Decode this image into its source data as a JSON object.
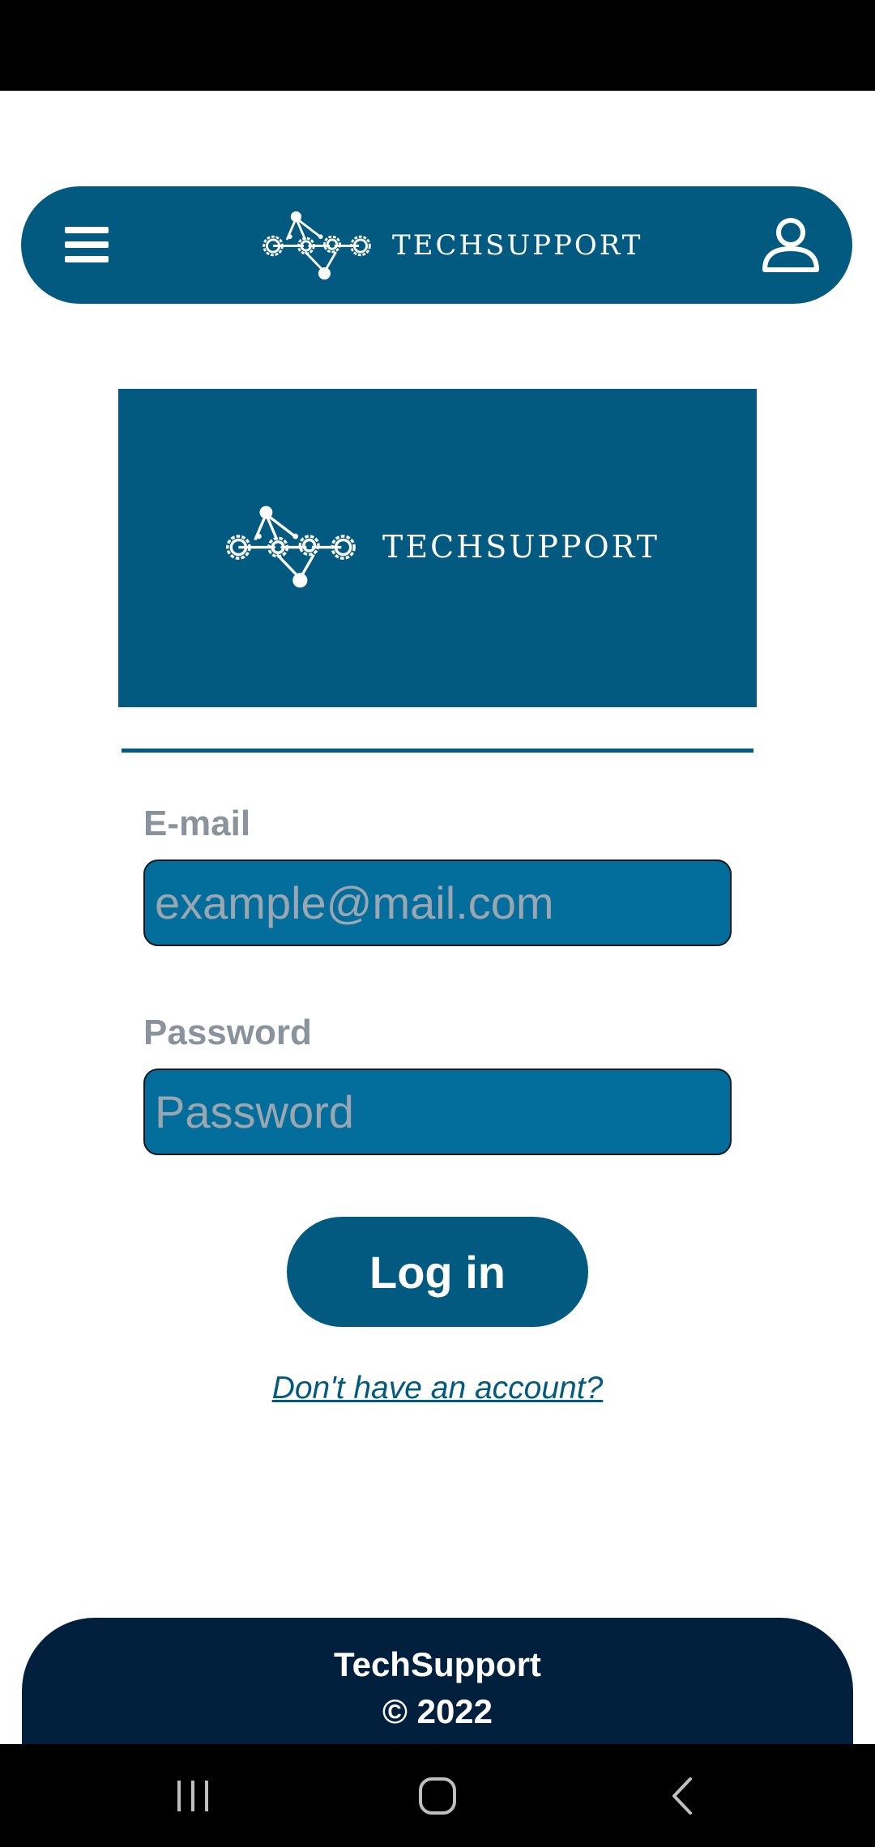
{
  "header": {
    "brand_name": "TECHSUPPORT",
    "icons": {
      "menu": "menu-icon",
      "logo": "gears-network-logo",
      "user": "user-icon"
    }
  },
  "hero": {
    "brand_name": "TECHSUPPORT"
  },
  "form": {
    "email_label": "E-mail",
    "email_placeholder": "example@mail.com",
    "password_label": "Password",
    "password_placeholder": "Password",
    "login_label": "Log in",
    "signup_link": "Don't have an account?"
  },
  "footer": {
    "name": "TechSupport",
    "copyright": "© 2022"
  },
  "colors": {
    "brand": "#035a80",
    "input_bg": "#036d9c",
    "footer_bg": "#00203d",
    "label_gray": "#8a939c"
  },
  "system_nav": {
    "icons": [
      "recent-apps-icon",
      "home-icon",
      "back-icon"
    ]
  }
}
